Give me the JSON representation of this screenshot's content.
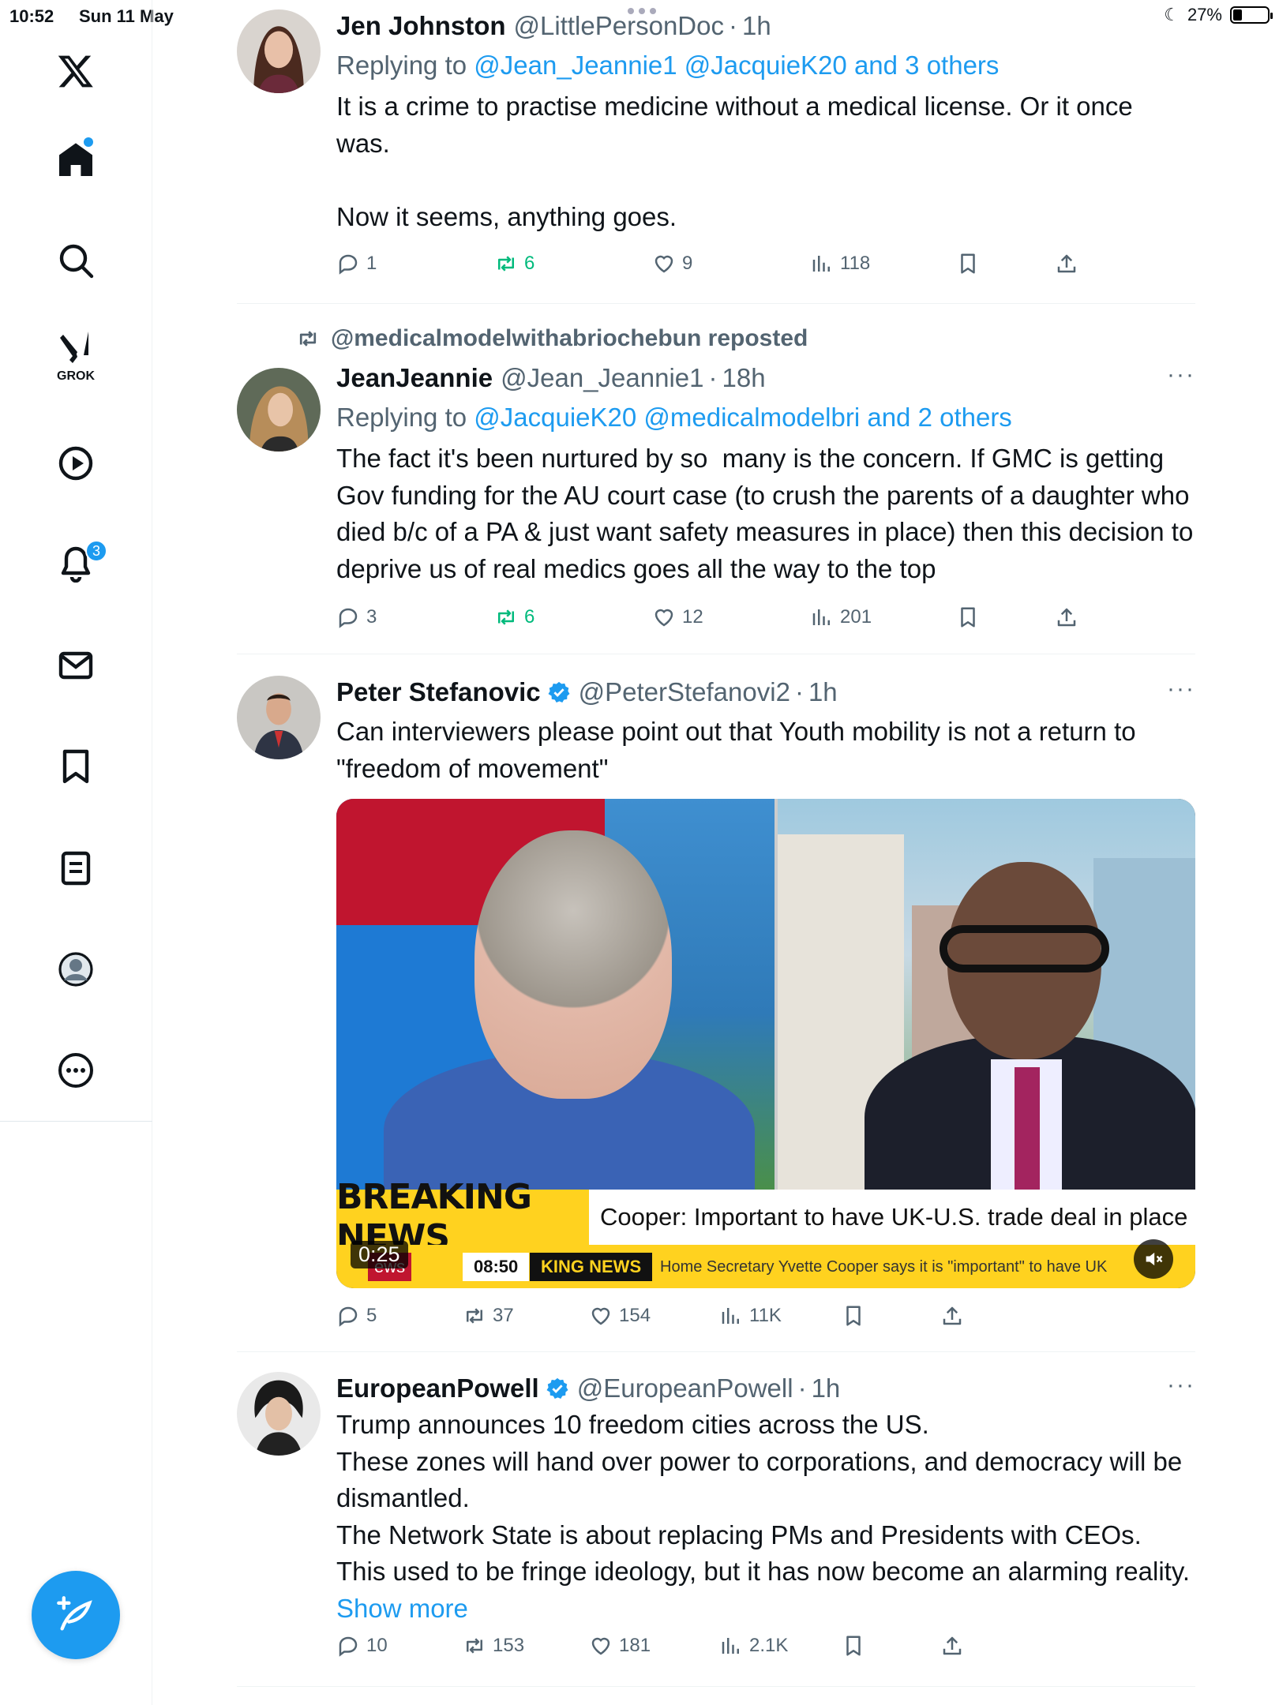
{
  "status_bar": {
    "time": "10:52",
    "date": "Sun 11 May",
    "battery": "27%",
    "battery_level": 0.27
  },
  "sidebar": {
    "grok_label": "GROK",
    "notifications_count": "3",
    "icons": [
      "x-logo-icon",
      "home-icon",
      "search-icon",
      "grok-icon",
      "video-icon",
      "bell-icon",
      "mail-icon",
      "bookmark-icon",
      "list-icon",
      "profile-icon",
      "more-icon",
      "compose-icon"
    ]
  },
  "colors": {
    "accent": "#1d9bf0",
    "muted_text": "#536471",
    "repost_green": "#00ba7c",
    "breaking_yellow": "#ffd21f"
  },
  "tweets": [
    {
      "display_name": "Jen Johnston",
      "handle": "@LittlePersonDoc",
      "time": "1h",
      "reply_prefix": "Replying to",
      "reply_mentions": "@Jean_Jeannie1 @JacquieK20 and 3 others",
      "text": "It is a crime to practise medicine without a medical license. Or it once\nwas.\n\nNow it seems, anything goes.",
      "replies": "1",
      "reposts": "6",
      "likes": "9",
      "views": "118"
    },
    {
      "repost_by": "@medicalmodelwithabriochebun reposted",
      "display_name": "JeanJeannie",
      "handle": "@Jean_Jeannie1",
      "time": "18h",
      "reply_prefix": "Replying to",
      "reply_mentions": "@JacquieK20 @medicalmodelbri and 2 others",
      "text": "The fact it's been nurtured by so  many is the concern. If GMC is getting Gov funding for the AU court case (to crush the parents of a daughter who died b/c of a PA & just want safety measures in place) then this decision to deprive us of real medics goes all the way to the top",
      "replies": "3",
      "reposts": "6",
      "likes": "12",
      "views": "201"
    },
    {
      "display_name": "Peter Stefanovic",
      "handle": "@PeterStefanovi2",
      "time": "1h",
      "text": "Can interviewers please point out that Youth mobility is not a return to \"freedom of movement\"",
      "video": {
        "breaking_label": "BREAKING NEWS",
        "headline": "Cooper: Important to have UK-U.S. trade deal in place",
        "channel_logo": "ews",
        "clock": "08:50",
        "ticker_tag": "KING NEWS",
        "ticker_text": "Home Secretary Yvette Cooper says it is \"important\" to have UK",
        "duration": "0:25"
      },
      "replies": "5",
      "reposts": "37",
      "likes": "154",
      "views": "11K"
    },
    {
      "display_name": "EuropeanPowell",
      "handle": "@EuropeanPowell",
      "time": "1h",
      "text": "Trump announces 10 freedom cities across the US.\nThese zones will hand over power to corporations, and democracy will be dismantled.\nThe Network State is about replacing PMs and Presidents with CEOs.\nThis used to be fringe ideology, but it has now become an alarming reality. ",
      "show_more": "Show more",
      "replies": "10",
      "reposts": "153",
      "likes": "181",
      "views": "2.1K"
    }
  ]
}
